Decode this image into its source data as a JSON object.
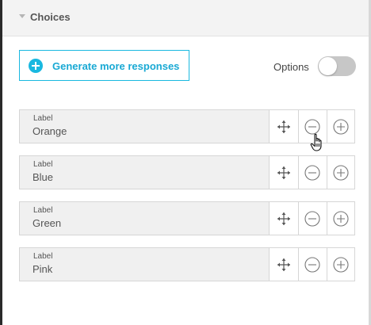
{
  "section": {
    "title": "Choices"
  },
  "actions": {
    "generate_label": "Generate more responses"
  },
  "options": {
    "label": "Options",
    "enabled": false
  },
  "choices": [
    {
      "field_label": "Label",
      "value": "Orange"
    },
    {
      "field_label": "Label",
      "value": "Blue"
    },
    {
      "field_label": "Label",
      "value": "Green"
    },
    {
      "field_label": "Label",
      "value": "Pink"
    }
  ],
  "icons": [
    "caret-down-icon",
    "add-circle-icon",
    "move-icon",
    "remove-circle-icon",
    "add-outline-circle-icon",
    "hand-cursor-icon"
  ],
  "colors": {
    "accent": "#19b8e0",
    "toggle_off": "#c7c7c7",
    "field_bg": "#f0f0f0"
  }
}
